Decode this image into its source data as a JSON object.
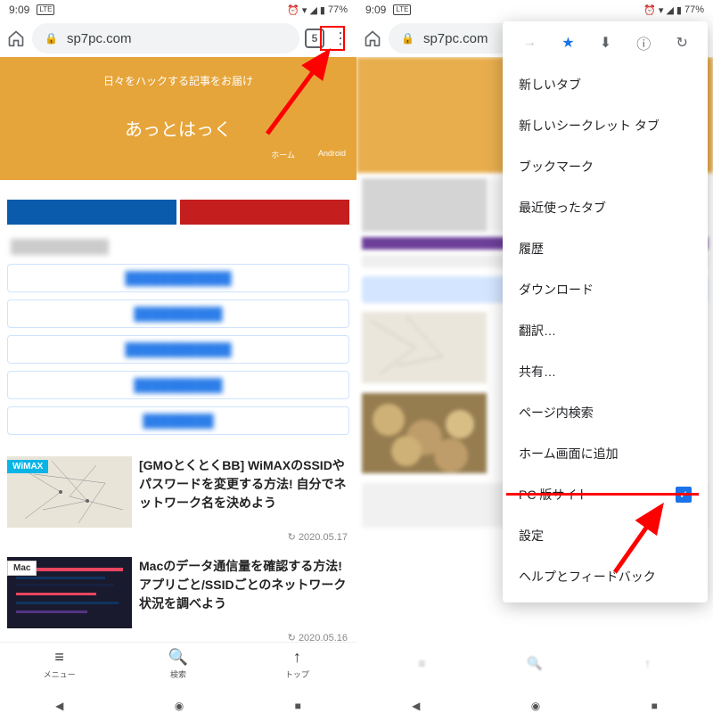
{
  "status": {
    "time": "9:09",
    "battery": "77%"
  },
  "chrome": {
    "url": "sp7pc.com",
    "tab_count": "5"
  },
  "site": {
    "tagline": "日々をハックする記事をお届け",
    "title": "あっとはっく",
    "nav1": "ホーム",
    "nav2": "Android"
  },
  "articles": [
    {
      "badge": "WiMAX",
      "title": "[GMOとくとくBB] WiMAXのSSIDやパスワードを変更する方法! 自分でネットワーク名を決めよう",
      "date": "2020.05.17"
    },
    {
      "badge": "Mac",
      "title": "Macのデータ通信量を確認する方法! アプリごと/SSIDごとのネットワーク状況を調べよう",
      "date": "2020.05.16"
    }
  ],
  "bottom": {
    "menu": "メニュー",
    "search": "検索",
    "top": "トップ"
  },
  "menu": {
    "new_tab": "新しいタブ",
    "incognito": "新しいシークレット タブ",
    "bookmarks": "ブックマーク",
    "recent": "最近使ったタブ",
    "history": "履歴",
    "downloads": "ダウンロード",
    "translate": "翻訳…",
    "share": "共有…",
    "find": "ページ内検索",
    "add_home": "ホーム画面に追加",
    "desktop": "PC 版サイト",
    "settings": "設定",
    "help": "ヘルプとフィードバック"
  }
}
